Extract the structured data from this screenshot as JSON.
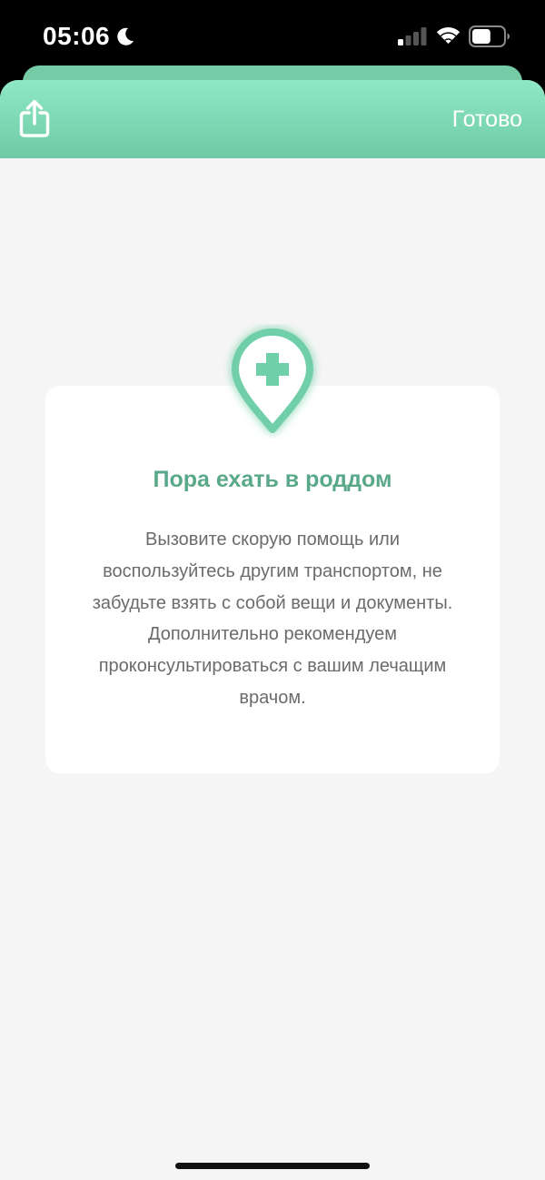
{
  "status_bar": {
    "time": "05:06",
    "icons": [
      "moon-icon",
      "cellular-signal-icon",
      "wifi-icon",
      "battery-icon"
    ],
    "signal_bars_filled": 1,
    "signal_bars_total": 4,
    "battery_level": 0.6
  },
  "nav": {
    "done_label": "Готово",
    "share_icon": "share-icon"
  },
  "card": {
    "icon": "medical-location-pin-icon",
    "title": "Пора ехать в роддом",
    "text": "Вызовите скорую помощь или воспользуйтесь другим транспортом, не забудьте взять с собой вещи и документы. Дополнительно рекомендуем проконсультироваться с вашим лечащим врачом."
  },
  "colors": {
    "accent": "#6fcaa5",
    "accent_light": "#8ee8c6",
    "title": "#5aa88a",
    "body_text": "#6b6b6b",
    "background": "#f5f5f5"
  }
}
